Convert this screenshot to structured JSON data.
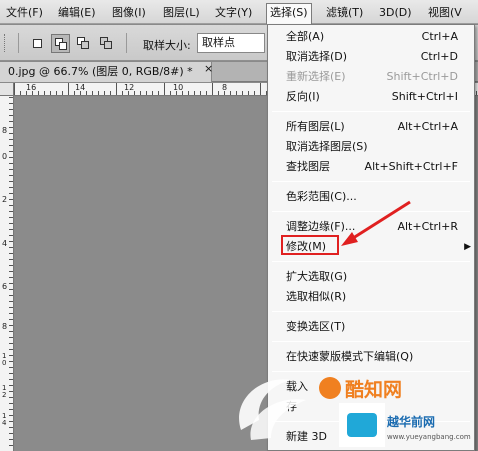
{
  "menubar": {
    "items": [
      {
        "label": "文件(F)"
      },
      {
        "label": "编辑(E)"
      },
      {
        "label": "图像(I)"
      },
      {
        "label": "图层(L)"
      },
      {
        "label": "文字(Y)"
      },
      {
        "label": "选择(S)"
      },
      {
        "label": "滤镜(T)"
      },
      {
        "label": "3D(D)"
      },
      {
        "label": "视图(V"
      }
    ],
    "active_index": 5
  },
  "options": {
    "sample_size_label": "取样大小:",
    "sample_size_value": "取样点"
  },
  "document": {
    "tab_title": "0.jpg @ 66.7% (图层 0, RGB/8#) *",
    "close_glyph": "×"
  },
  "rulers": {
    "top_labels": [
      "16",
      "14",
      "12",
      "10",
      "8",
      "6",
      "4"
    ],
    "left_labels": [
      "8",
      "0",
      "2",
      "4",
      "6",
      "8",
      "1 0",
      "1 2",
      "1 4",
      "1 6"
    ]
  },
  "select_menu": {
    "items": [
      {
        "label": "全部(A)",
        "shortcut": "Ctrl+A",
        "enabled": true
      },
      {
        "label": "取消选择(D)",
        "shortcut": "Ctrl+D",
        "enabled": true
      },
      {
        "label": "重新选择(E)",
        "shortcut": "Shift+Ctrl+D",
        "enabled": false
      },
      {
        "label": "反向(I)",
        "shortcut": "Shift+Ctrl+I",
        "enabled": true
      },
      {
        "label": "所有图层(L)",
        "shortcut": "Alt+Ctrl+A",
        "enabled": true
      },
      {
        "label": "取消选择图层(S)",
        "shortcut": "",
        "enabled": true
      },
      {
        "label": "查找图层",
        "shortcut": "Alt+Shift+Ctrl+F",
        "enabled": true
      },
      {
        "label": "色彩范围(C)...",
        "shortcut": "",
        "enabled": true
      },
      {
        "label": "调整边缘(F)...",
        "shortcut": "Alt+Ctrl+R",
        "enabled": true
      },
      {
        "label": "修改(M)",
        "shortcut": "",
        "enabled": true,
        "has_submenu": true
      },
      {
        "label": "扩大选取(G)",
        "shortcut": "",
        "enabled": true
      },
      {
        "label": "选取相似(R)",
        "shortcut": "",
        "enabled": true
      },
      {
        "label": "变换选区(T)",
        "shortcut": "",
        "enabled": true
      },
      {
        "label": "在快速蒙版模式下编辑(Q)",
        "shortcut": "",
        "enabled": true
      },
      {
        "label": "载入",
        "shortcut": "",
        "enabled": true
      },
      {
        "label": "存",
        "shortcut": "",
        "enabled": true
      },
      {
        "label": "新建 3D",
        "shortcut": "",
        "enabled": true
      }
    ],
    "highlighted_label": "修改(M)"
  },
  "watermark": {
    "brand_cn": "酷知网",
    "brand2_cn": "越华前网",
    "url": "www.yueyangbang.com"
  },
  "colors": {
    "highlight_box": "#e02020",
    "arrow": "#e02020",
    "canvas": "#8b8b8b"
  }
}
